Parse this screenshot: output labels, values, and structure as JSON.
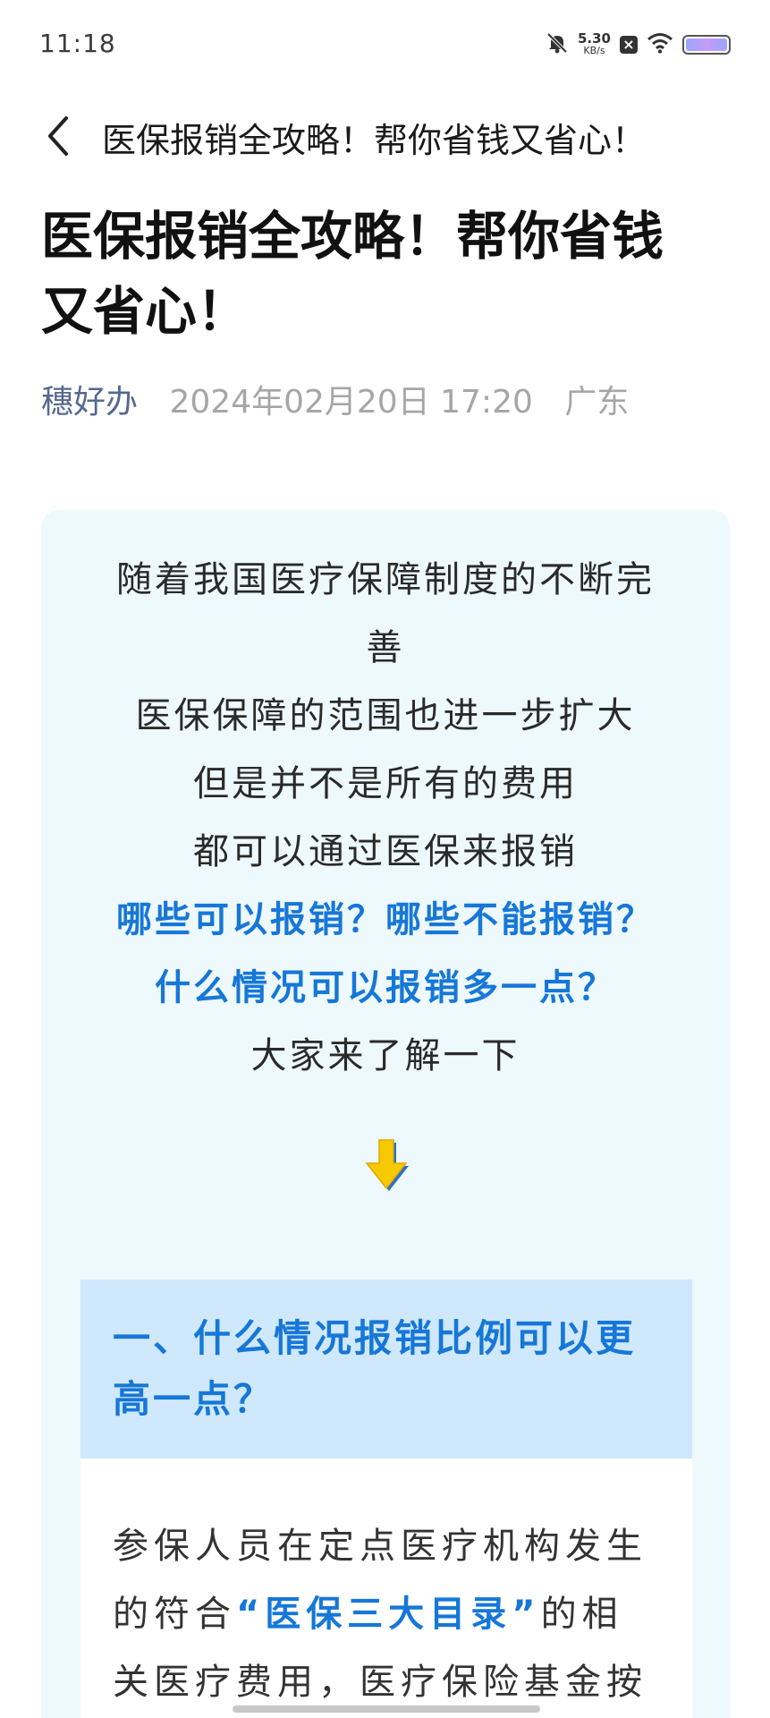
{
  "status_bar": {
    "time": "11:18",
    "net_speed_value": "5.30",
    "net_speed_unit": "KB/s",
    "icons": [
      "mute-bell-icon",
      "notification-box-icon",
      "wifi-icon",
      "battery-icon"
    ]
  },
  "nav": {
    "back_icon": "chevron-left-icon",
    "title": "医保报销全攻略！帮你省钱又省心！"
  },
  "article": {
    "title_line1": "医保报销全攻略！帮你省钱",
    "title_line2": "又省心！",
    "author": "穗好办",
    "date": "2024年02月20日 17:20",
    "location": "广东"
  },
  "intro": {
    "lines": [
      "随着我国医疗保障制度的不断完",
      "善",
      "医保保障的范围也进一步扩大",
      "但是并不是所有的费用",
      "都可以通过医保来报销"
    ],
    "highlight_lines": [
      "哪些可以报销？哪些不能报销？",
      "什么情况可以报销多一点？"
    ],
    "closing_line": "大家来了解一下",
    "arrow_icon": "down-arrow-icon"
  },
  "section1": {
    "title_line1": "一、什么情况报销比例可以更",
    "title_line2": "高一点？",
    "body_line1": "参保人员在定点医疗机构发生",
    "body_line2_pre": "的符合",
    "body_line2_strong": "“医保三大目录”",
    "body_line2_post": "的相",
    "body_line3": "关医疗费用，医疗保险基金按"
  },
  "colors": {
    "accent_blue": "#1677d8",
    "card_bg": "#eef9fd",
    "section_header_bg": "#cfe8fb",
    "author_color": "#55698f",
    "meta_gray": "#a6a6a6"
  }
}
